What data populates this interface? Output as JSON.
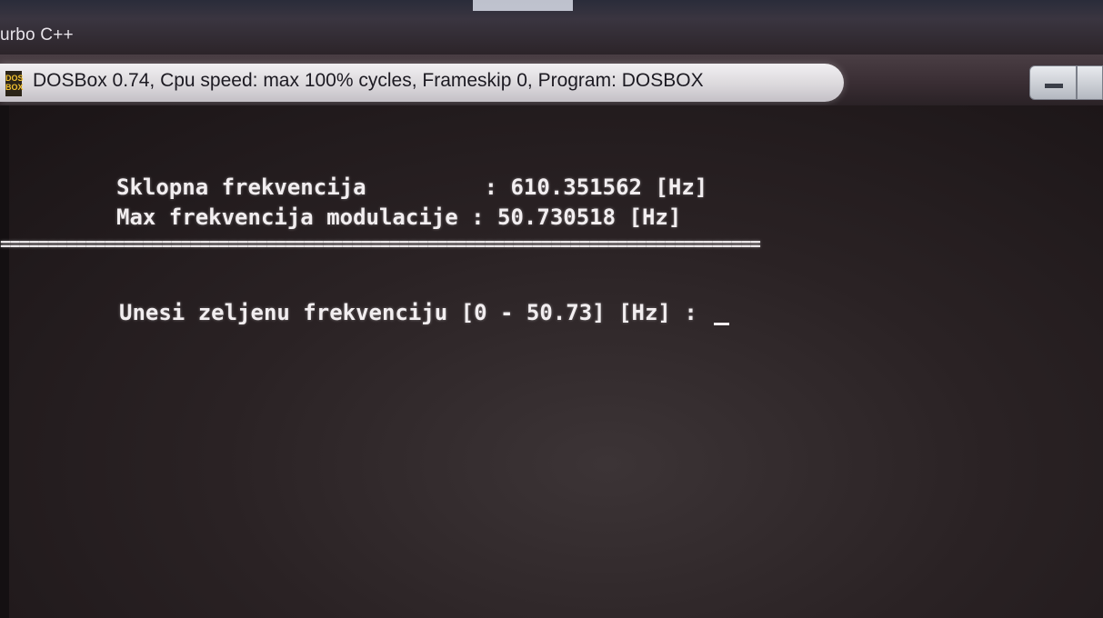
{
  "outer_window": {
    "title": "urbo C++"
  },
  "dosbox_window": {
    "icon_text": "DOS BOX",
    "title": "DOSBox 0.74, Cpu speed: max 100% cycles, Frameskip  0, Program:  DOSBOX"
  },
  "console": {
    "line_sklopna": "Sklopna frekvencija         : 610.351562 [Hz]",
    "line_max": "Max frekvencija modulacije : 50.730518 [Hz]",
    "separator": "================================================================================",
    "prompt": "Unesi zeljenu frekvenciju [0 - 50.73] [Hz] : "
  },
  "colors": {
    "console_text": "#f2eef0",
    "console_bg": "#1c1618",
    "title_pill": "#e6e4e8"
  }
}
